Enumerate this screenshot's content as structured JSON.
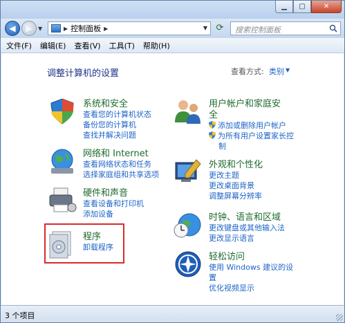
{
  "nav": {
    "breadcrumb": "控制面板",
    "search_placeholder": "搜索控制面板"
  },
  "menu": [
    "文件(F)",
    "编辑(E)",
    "查看(V)",
    "工具(T)",
    "帮助(H)"
  ],
  "page": {
    "title": "调整计算机的设置",
    "view_by_label": "查看方式:",
    "view_by_value": "类别"
  },
  "categories": [
    {
      "title": "系统和安全",
      "links": [
        "查看您的计算机状态",
        "备份您的计算机",
        "查找并解决问题"
      ]
    },
    {
      "title": "网络和 Internet",
      "links": [
        "查看网络状态和任务",
        "选择家庭组和共享选项"
      ]
    },
    {
      "title": "硬件和声音",
      "links": [
        "查看设备和打印机",
        "添加设备"
      ]
    },
    {
      "title": "程序",
      "links": [
        "卸载程序"
      ]
    },
    {
      "title_line1": "用户帐户和家庭安",
      "title_line2": "全",
      "links": [
        "添加或删除用户帐户",
        "为所有用户设置家长控",
        "制"
      ]
    },
    {
      "title": "外观和个性化",
      "links": [
        "更改主题",
        "更改桌面背景",
        "调整屏幕分辨率"
      ]
    },
    {
      "title": "时钟、语言和区域",
      "links": [
        "更改键盘或其他输入法",
        "更改显示语言"
      ]
    },
    {
      "title": "轻松访问",
      "links": [
        "使用 Windows 建议的设",
        "置",
        "优化视频显示"
      ]
    }
  ],
  "status": {
    "text": "3 个项目"
  },
  "colors": {
    "category_title": "#1e6a2e",
    "link": "#1e64c8",
    "highlight": "#d92a2a"
  }
}
